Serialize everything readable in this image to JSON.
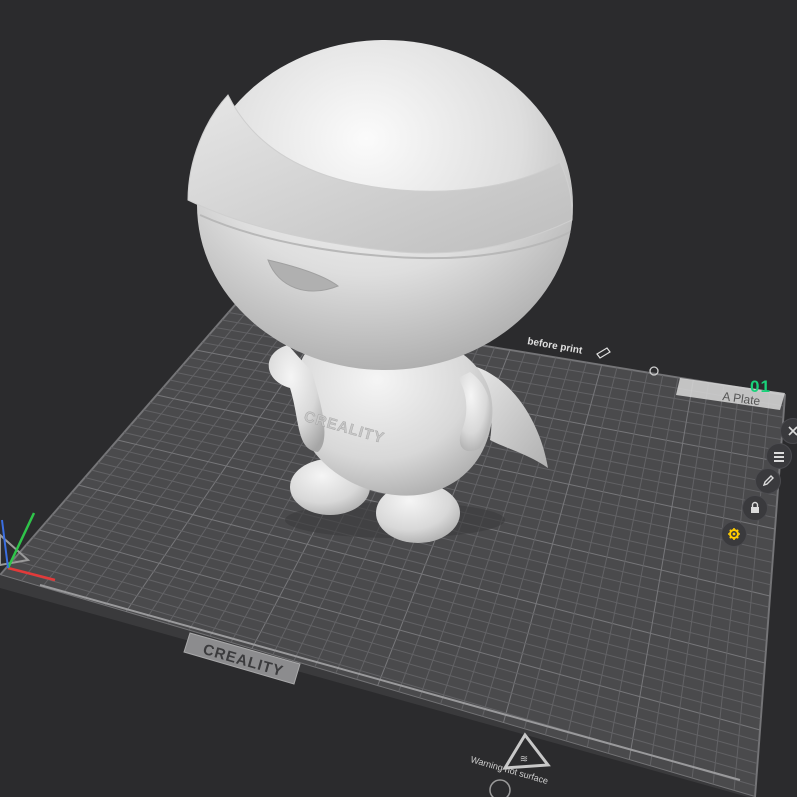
{
  "plate": {
    "number": "01",
    "name": "A Plate",
    "before_print_label": "before print",
    "number_color": "#19d27a"
  },
  "bed": {
    "brand_front": "CREALITY",
    "warning_text": "Warning hot surface"
  },
  "model": {
    "chest_logo": "CREALITY"
  },
  "side_toolbar": {
    "icons": [
      "close-icon",
      "list-icon",
      "edit-icon",
      "lock-icon",
      "settings-gear-icon"
    ],
    "accent_color": "#ffcc00"
  }
}
